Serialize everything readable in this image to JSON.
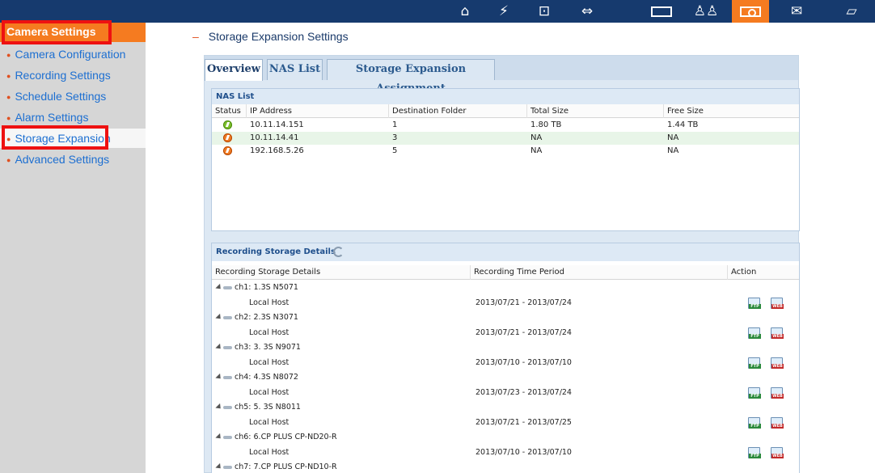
{
  "topbar": {
    "icons": [
      {
        "name": "home-icon",
        "glyph": "⌂"
      },
      {
        "name": "flash-icon",
        "glyph": "⚡"
      },
      {
        "name": "network-icon",
        "glyph": "⊡"
      },
      {
        "name": "plug-icon",
        "glyph": "⇔"
      },
      {
        "name": "storage-icon",
        "glyph": "▭"
      },
      {
        "name": "users-icon",
        "glyph": "♙♙"
      },
      {
        "name": "camera-icon",
        "glyph": "◉"
      },
      {
        "name": "mail-icon",
        "glyph": "✉"
      },
      {
        "name": "tag-icon",
        "glyph": "▱"
      }
    ],
    "active_index": 6
  },
  "sidebar": {
    "header": "Camera Settings",
    "items": [
      {
        "label": "Camera Configuration"
      },
      {
        "label": "Recording Settings"
      },
      {
        "label": "Schedule Settings"
      },
      {
        "label": "Alarm Settings"
      },
      {
        "label": "Storage Expansion"
      },
      {
        "label": "Advanced Settings"
      }
    ],
    "selected_index": 4
  },
  "page": {
    "title": "Storage Expansion Settings",
    "tabs": [
      {
        "label": "Overview"
      },
      {
        "label": "NAS List"
      },
      {
        "label": "Storage Expansion Assignment"
      }
    ],
    "active_tab": 0
  },
  "nas_list": {
    "title": "NAS List",
    "columns": [
      "Status",
      "IP Address",
      "Destination Folder",
      "Total Size",
      "Free Size"
    ],
    "rows": [
      {
        "status": "ok",
        "ip": "10.11.14.151",
        "folder": "1",
        "total": "1.80 TB",
        "free": "1.44 TB"
      },
      {
        "status": "error",
        "ip": "10.11.14.41",
        "folder": "3",
        "total": "NA",
        "free": "NA"
      },
      {
        "status": "error",
        "ip": "192.168.5.26",
        "folder": "5",
        "total": "NA",
        "free": "NA"
      }
    ]
  },
  "recording": {
    "title": "Recording Storage Details",
    "columns": [
      "Recording Storage Details",
      "Recording Time Period",
      "Action"
    ],
    "action_icons": [
      "FTP",
      "WEB"
    ],
    "channels": [
      {
        "name": "ch1: 1.3S N5071",
        "host": "Local Host",
        "period": "2013/07/21 - 2013/07/24"
      },
      {
        "name": "ch2: 2.3S N3071",
        "host": "Local Host",
        "period": "2013/07/21 - 2013/07/24"
      },
      {
        "name": "ch3: 3. 3S N9071",
        "host": "Local Host",
        "period": "2013/07/10 - 2013/07/10"
      },
      {
        "name": "ch4: 4.3S N8072",
        "host": "Local Host",
        "period": "2013/07/23 - 2013/07/24"
      },
      {
        "name": "ch5: 5. 3S N8011",
        "host": "Local Host",
        "period": "2013/07/21 - 2013/07/25"
      },
      {
        "name": "ch6: 6.CP PLUS CP-ND20-R",
        "host": "Local Host",
        "period": "2013/07/10 - 2013/07/10"
      },
      {
        "name": "ch7: 7.CP PLUS CP-ND10-R",
        "host": "",
        "period": ""
      }
    ]
  },
  "colors": {
    "topbar": "#163a6e",
    "accent": "#f57b20",
    "highlight_box": "#ee1111",
    "sidebar_link": "#1d6fd1"
  }
}
